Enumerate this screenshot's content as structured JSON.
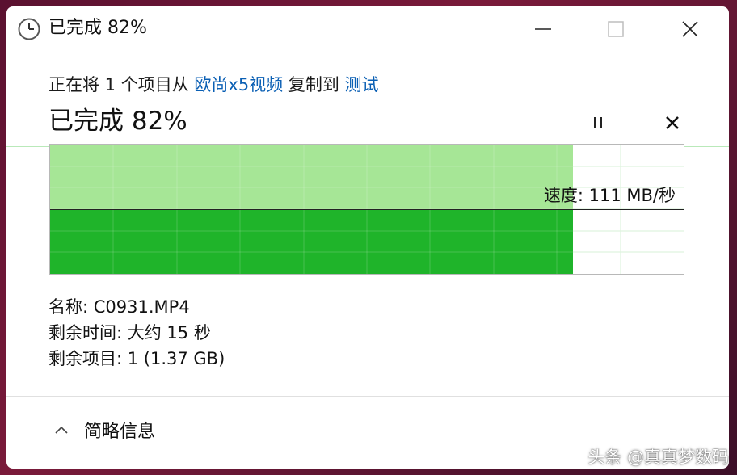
{
  "window": {
    "title": "已完成 82%",
    "icon": "clock-icon"
  },
  "transfer": {
    "prefix": "正在将 1 个项目从 ",
    "source": "欧尚x5视频",
    "middle": " 复制到 ",
    "destination": "测试",
    "status": "已完成 82%",
    "progress_percent": 82
  },
  "graph": {
    "speed_text": "速度: 111 MB/秒"
  },
  "details": {
    "name": "名称:  C0931.MP4",
    "time_remaining": "剩余时间:  大约 15 秒",
    "items_remaining": "剩余项目:  1 (1.37 GB)"
  },
  "footer": {
    "toggle_label": "简略信息"
  },
  "watermark": "头条 @真真梦数码",
  "colors": {
    "progress_light": "#a6e696",
    "progress_dark": "#1fb42a",
    "link": "#0a5fb4"
  }
}
